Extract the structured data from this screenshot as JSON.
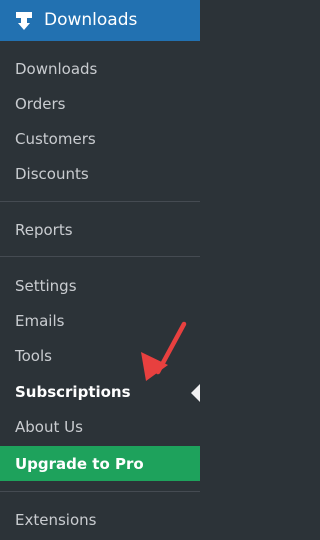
{
  "header": {
    "title": "Downloads",
    "icon": "download-icon",
    "color": "#2271b1"
  },
  "menu": {
    "group1": [
      {
        "label": "Downloads"
      },
      {
        "label": "Orders"
      },
      {
        "label": "Customers"
      },
      {
        "label": "Discounts"
      }
    ],
    "group2": [
      {
        "label": "Reports"
      }
    ],
    "group3": [
      {
        "label": "Settings"
      },
      {
        "label": "Emails"
      },
      {
        "label": "Tools"
      },
      {
        "label": "Subscriptions",
        "active": true
      },
      {
        "label": "About Us"
      },
      {
        "label": "Upgrade to Pro",
        "highlight_color": "#1ea25c"
      }
    ],
    "group4": [
      {
        "label": "Extensions"
      }
    ]
  },
  "annotation": {
    "arrow_color": "#e8403f",
    "points_to": "Subscriptions"
  }
}
